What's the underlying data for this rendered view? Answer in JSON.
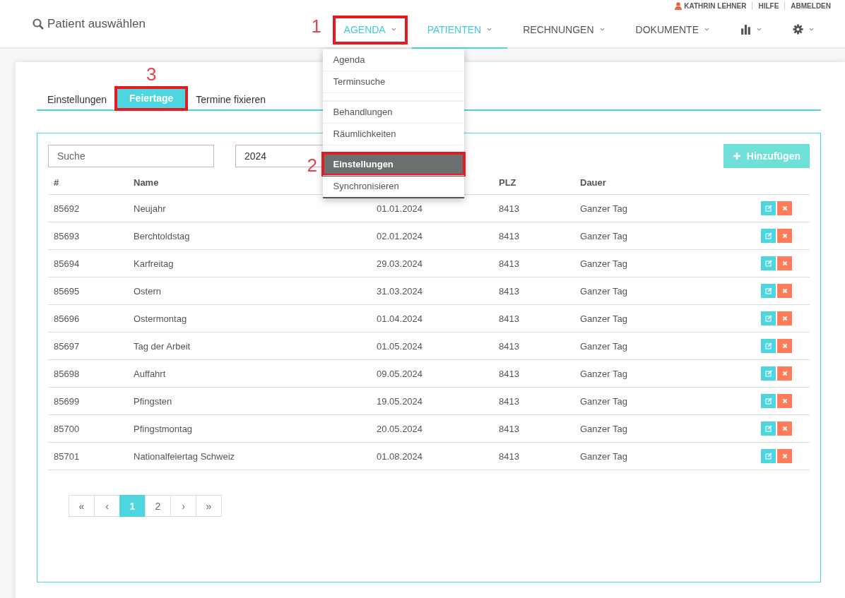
{
  "user_bar": {
    "user": "KATHRIN LEHNER",
    "links": [
      "HILFE",
      "ABMELDEN"
    ]
  },
  "patient_search": {
    "label": "Patient auswählen"
  },
  "nav": [
    {
      "kind": "text",
      "label": "AGENDA",
      "selected": false,
      "open": true,
      "callout": "1"
    },
    {
      "kind": "text",
      "label": "PATIENTEN",
      "selected": true,
      "open": false
    },
    {
      "kind": "text",
      "label": "RECHNUNGEN",
      "selected": false,
      "open": false
    },
    {
      "kind": "text",
      "label": "DOKUMENTE",
      "selected": false,
      "open": false
    },
    {
      "kind": "chart",
      "selected": false,
      "open": false
    },
    {
      "kind": "gear",
      "selected": false,
      "open": false
    }
  ],
  "dropdown": [
    {
      "kind": "item",
      "label": "Agenda",
      "selected": false
    },
    {
      "kind": "item",
      "label": "Terminsuche",
      "selected": false
    },
    {
      "kind": "divider"
    },
    {
      "kind": "item",
      "label": "Behandlungen",
      "selected": false
    },
    {
      "kind": "item",
      "label": "Räumlichkeiten",
      "selected": false
    },
    {
      "kind": "divider"
    },
    {
      "kind": "item",
      "label": "Einstellungen",
      "selected": true,
      "callout": "2"
    },
    {
      "kind": "item",
      "label": "Synchronisieren",
      "selected": false
    }
  ],
  "tabs": [
    {
      "label": "Einstellungen",
      "selected": false
    },
    {
      "label": "Feiertage",
      "selected": true,
      "callout": "3"
    },
    {
      "label": "Termine fixieren",
      "selected": false
    }
  ],
  "search": {
    "placeholder": "Suche"
  },
  "year": {
    "value": "2024"
  },
  "add_button": {
    "label": "Hinzufügen"
  },
  "table": {
    "columns": [
      "#",
      "Name",
      "",
      "PLZ",
      "Dauer"
    ],
    "rows": [
      [
        "85692",
        "Neujahr",
        "01.01.2024",
        "8413",
        "Ganzer Tag"
      ],
      [
        "85693",
        "Berchtoldstag",
        "02.01.2024",
        "8413",
        "Ganzer Tag"
      ],
      [
        "85694",
        "Karfreitag",
        "29.03.2024",
        "8413",
        "Ganzer Tag"
      ],
      [
        "85695",
        "Ostern",
        "31.03.2024",
        "8413",
        "Ganzer Tag"
      ],
      [
        "85696",
        "Ostermontag",
        "01.04.2024",
        "8413",
        "Ganzer Tag"
      ],
      [
        "85697",
        "Tag der Arbeit",
        "01.05.2024",
        "8413",
        "Ganzer Tag"
      ],
      [
        "85698",
        "Auffahrt",
        "09.05.2024",
        "8413",
        "Ganzer Tag"
      ],
      [
        "85699",
        "Pfingsten",
        "19.05.2024",
        "8413",
        "Ganzer Tag"
      ],
      [
        "85700",
        "Pfingstmontag",
        "20.05.2024",
        "8413",
        "Ganzer Tag"
      ],
      [
        "85701",
        "Nationalfeiertag Schweiz",
        "01.08.2024",
        "8413",
        "Ganzer Tag"
      ]
    ]
  },
  "pagination": [
    {
      "label": "«",
      "selected": false
    },
    {
      "label": "‹",
      "selected": false
    },
    {
      "label": "1",
      "selected": true
    },
    {
      "label": "2",
      "selected": false
    },
    {
      "label": "›",
      "selected": false
    },
    {
      "label": "»",
      "selected": false
    }
  ]
}
